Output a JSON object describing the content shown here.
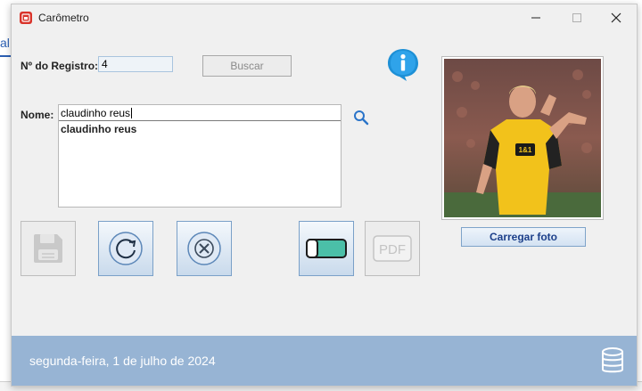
{
  "window": {
    "title": "Carômetro",
    "controls": {
      "minimize": "minimize-icon",
      "maximize": "maximize-icon",
      "close": "close-icon"
    }
  },
  "form": {
    "registro_label": "Nº do Registro:",
    "registro_value": "4",
    "buscar_label": "Buscar",
    "nome_label": "Nome:",
    "nome_value": "claudinho reus",
    "suggestions": [
      "claudinho reus"
    ],
    "carregar_foto_label": "Carregar foto"
  },
  "toolbar": {
    "buttons": [
      {
        "icon": "floppy-disk-icon",
        "enabled": false
      },
      {
        "icon": "refresh-icon",
        "enabled": true
      },
      {
        "icon": "delete-x-icon",
        "enabled": true
      },
      {
        "icon": "eraser-icon",
        "enabled": true
      },
      {
        "icon": "pdf-icon",
        "enabled": false,
        "label": "PDF"
      }
    ]
  },
  "status": {
    "date": "segunda-feira, 1 de julho de 2024",
    "db_icon": "database-icon"
  },
  "colors": {
    "accent": "#97b4d4",
    "app_icon": "#d9342b",
    "button_text": "#1c3f8a",
    "info_icon": "#1e90d6"
  }
}
